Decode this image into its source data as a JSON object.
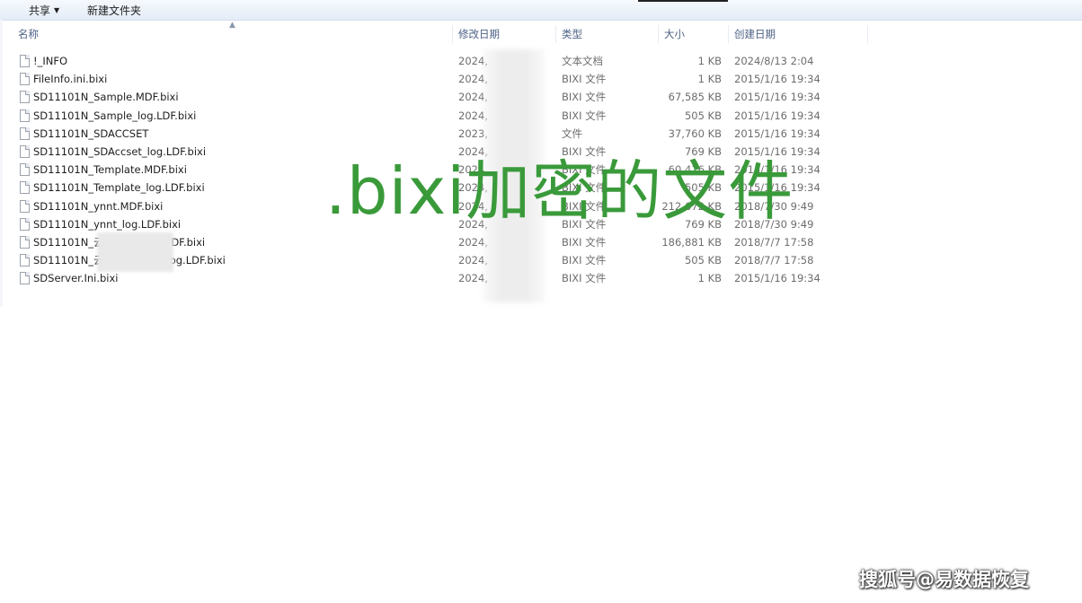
{
  "toolbar": {
    "share_label": "共享",
    "new_folder_label": "新建文件夹"
  },
  "columns": {
    "name": "名称",
    "modified": "修改日期",
    "type": "类型",
    "size": "大小",
    "created": "创建日期"
  },
  "files": [
    {
      "name": "!_INFO",
      "modified": "2024,",
      "type": "文本文档",
      "size": "1 KB",
      "created": "2024/8/13 2:04"
    },
    {
      "name": "FileInfo.ini.bixi",
      "modified": "2024,",
      "type": "BIXI 文件",
      "size": "1 KB",
      "created": "2015/1/16 19:34"
    },
    {
      "name": "SD11101N_Sample.MDF.bixi",
      "modified": "2024,",
      "type": "BIXI 文件",
      "size": "67,585 KB",
      "created": "2015/1/16 19:34"
    },
    {
      "name": "SD11101N_Sample_log.LDF.bixi",
      "modified": "2024,",
      "type": "BIXI 文件",
      "size": "505 KB",
      "created": "2015/1/16 19:34"
    },
    {
      "name": "SD11101N_SDACCSET",
      "modified": "2023,",
      "type": "文件",
      "size": "37,760 KB",
      "created": "2015/1/16 19:34"
    },
    {
      "name": "SD11101N_SDAccset_log.LDF.bixi",
      "modified": "2024,",
      "type": "BIXI 文件",
      "size": "769 KB",
      "created": "2015/1/16 19:34"
    },
    {
      "name": "SD11101N_Template.MDF.bixi",
      "modified": "2024,",
      "type": "BIXI 文件",
      "size": "60,416 KB",
      "created": "2015/1/16 19:34"
    },
    {
      "name": "SD11101N_Template_log.LDF.bixi",
      "modified": "2024,",
      "type": "BIXI 文件",
      "size": "505 KB",
      "created": "2015/1/16 19:34"
    },
    {
      "name": "SD11101N_ynnt.MDF.bixi",
      "modified": "2024,",
      "type": "BIXI 文件",
      "size": "212,672 KB",
      "created": "2018/7/30 9:49"
    },
    {
      "name": "SD11101N_ynnt_log.LDF.bixi",
      "modified": "2024,",
      "type": "BIXI 文件",
      "size": "769 KB",
      "created": "2018/7/30 9:49"
    },
    {
      "name": "SD11101N_云        技有限公司.MDF.bixi",
      "modified": "2024,",
      "type": "BIXI 文件",
      "size": "186,881 KB",
      "created": "2018/7/7 17:58"
    },
    {
      "name": "SD11101N_云        技有限公司_Log.LDF.bixi",
      "modified": "2024,",
      "type": "BIXI 文件",
      "size": "505 KB",
      "created": "2018/7/7 17:58"
    },
    {
      "name": "SDServer.Ini.bixi",
      "modified": "2024,",
      "type": "BIXI 文件",
      "size": "1 KB",
      "created": "2015/1/16 19:34"
    }
  ],
  "overlay_title": ".bixi加密的文件",
  "watermark": "搜狐号@易数据恢复",
  "colors": {
    "overlay_green": "#3a9a3a",
    "header_text": "#4d6185"
  }
}
